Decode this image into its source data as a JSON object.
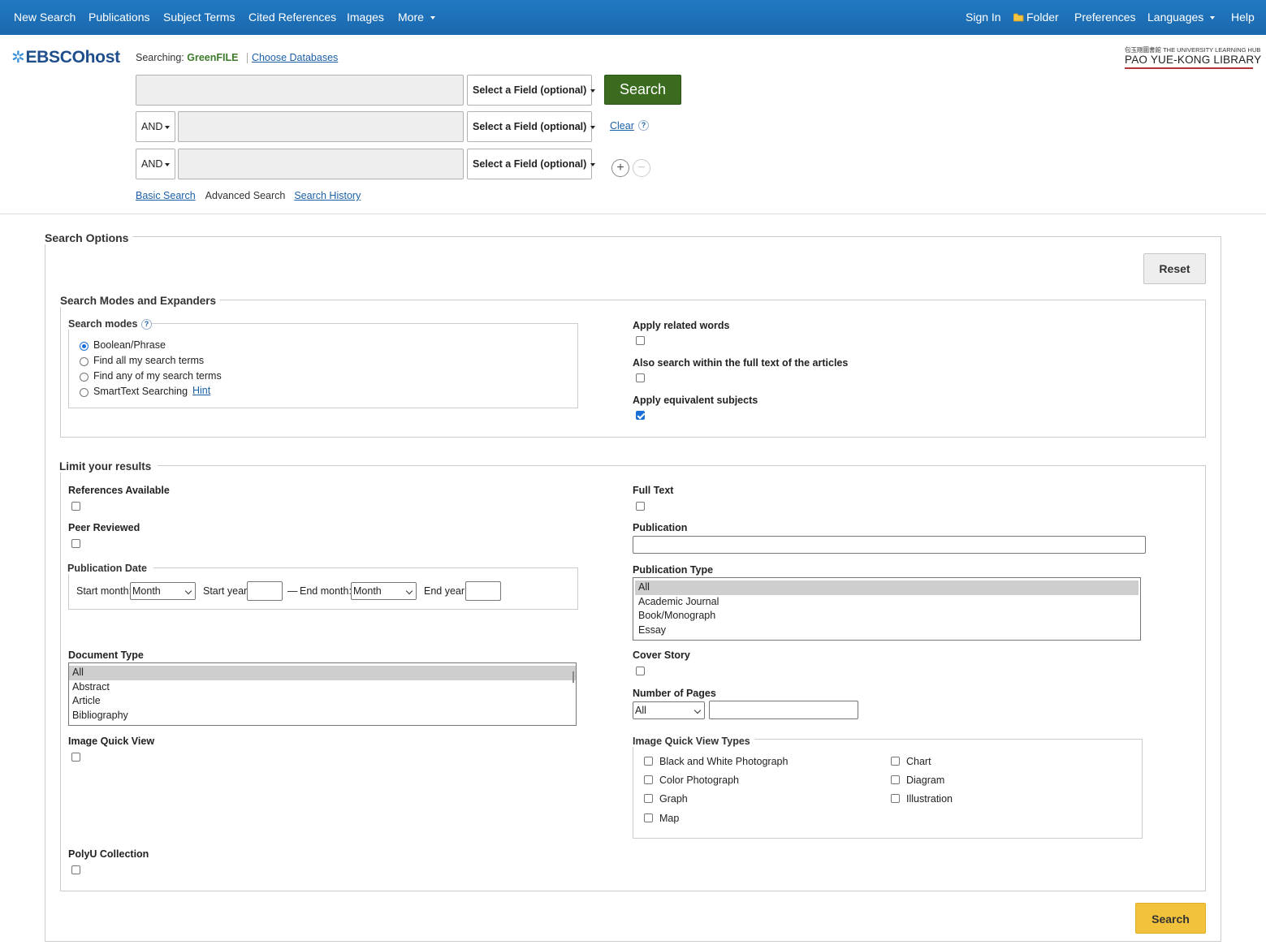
{
  "topnav": {
    "left": [
      "New Search",
      "Publications",
      "Subject Terms",
      "Cited References",
      "Images",
      "More"
    ],
    "right": {
      "sign_in": "Sign In",
      "folder": "Folder",
      "preferences": "Preferences",
      "languages": "Languages",
      "help": "Help"
    }
  },
  "header": {
    "logo": "EBSCOhost",
    "searching_label": "Searching:",
    "database": "GreenFILE",
    "choose_databases": "Choose Databases",
    "library_small": "包玉剛圖書館 THE UNIVERSITY LEARNING HUB",
    "library_name": "PAO YUE-KONG LIBRARY"
  },
  "search": {
    "rows": [
      {
        "operator": "",
        "field": "Select a Field (optional)",
        "value": ""
      },
      {
        "operator": "AND",
        "field": "Select a Field (optional)",
        "value": ""
      },
      {
        "operator": "AND",
        "field": "Select a Field (optional)",
        "value": ""
      }
    ],
    "search_button": "Search",
    "clear": "Clear",
    "help": "?",
    "add": "+",
    "remove": "−",
    "links": {
      "basic": "Basic Search",
      "advanced": "Advanced Search",
      "history": "Search History"
    }
  },
  "options": {
    "title": "Search Options",
    "reset": "Reset",
    "modes_section": "Search Modes and Expanders",
    "modes_label": "Search modes",
    "modes": [
      {
        "label": "Boolean/Phrase",
        "checked": true
      },
      {
        "label": "Find all my search terms",
        "checked": false
      },
      {
        "label": "Find any of my search terms",
        "checked": false
      },
      {
        "label": "SmartText Searching",
        "checked": false
      }
    ],
    "hint": "Hint",
    "expanders": [
      {
        "label": "Apply related words",
        "checked": false
      },
      {
        "label": "Also search within the full text of the articles",
        "checked": false
      },
      {
        "label": "Apply equivalent subjects",
        "checked": true
      }
    ]
  },
  "limits": {
    "title": "Limit your results",
    "references_available": "References Available",
    "peer_reviewed": "Peer Reviewed",
    "publication_date": "Publication Date",
    "start_month_label": "Start month:",
    "month_placeholder": "Month",
    "start_year_label": "Start year:",
    "dash": "—",
    "end_month_label": "End month:",
    "end_year_label": "End year:",
    "document_type": "Document Type",
    "document_types": [
      "All",
      "Abstract",
      "Article",
      "Bibliography"
    ],
    "image_quick_view": "Image Quick View",
    "polyu_collection": "PolyU Collection",
    "full_text": "Full Text",
    "publication": "Publication",
    "publication_type": "Publication Type",
    "publication_types": [
      "All",
      "Academic Journal",
      "Book/Monograph",
      "Essay"
    ],
    "cover_story": "Cover Story",
    "number_of_pages": "Number of Pages",
    "pages_option": "All",
    "image_types_label": "Image Quick View Types",
    "image_types_col1": [
      "Black and White Photograph",
      "Color Photograph",
      "Graph",
      "Map"
    ],
    "image_types_col2": [
      "Chart",
      "Diagram",
      "Illustration"
    ],
    "search_button": "Search"
  },
  "colors": {
    "topbar": "#1f73ba",
    "search_button": "#3b6b1e",
    "bottom_search": "#f2c23c",
    "database_name": "#3d7a2a"
  }
}
